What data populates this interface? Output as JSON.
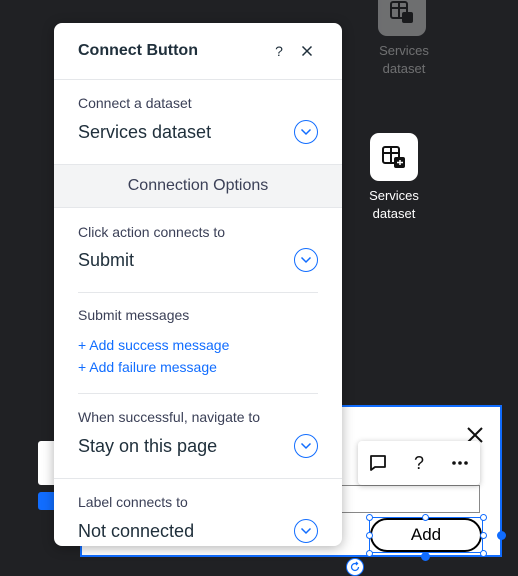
{
  "panel": {
    "title": "Connect Button",
    "help_label": "?",
    "close_label": "✕",
    "dataset": {
      "label": "Connect a dataset",
      "value": "Services dataset"
    },
    "options_header": "Connection Options",
    "click_action": {
      "label": "Click action connects to",
      "value": "Submit"
    },
    "submit_messages": {
      "label": "Submit messages",
      "add_success": "+ Add success message",
      "add_failure": "+ Add failure message"
    },
    "navigate": {
      "label": "When successful, navigate to",
      "value": "Stay on this page"
    },
    "label_conn": {
      "label": "Label connects to",
      "value": "Not connected"
    }
  },
  "canvas": {
    "dataset_icon_label_top": "Services\ndataset",
    "dataset_icon_label": "Services\ndataset",
    "button_text": "Add",
    "toolbar": {
      "help_label": "?"
    }
  },
  "colors": {
    "accent": "#116dff",
    "canvas_bg": "#202124",
    "text_dark": "#20303c"
  }
}
